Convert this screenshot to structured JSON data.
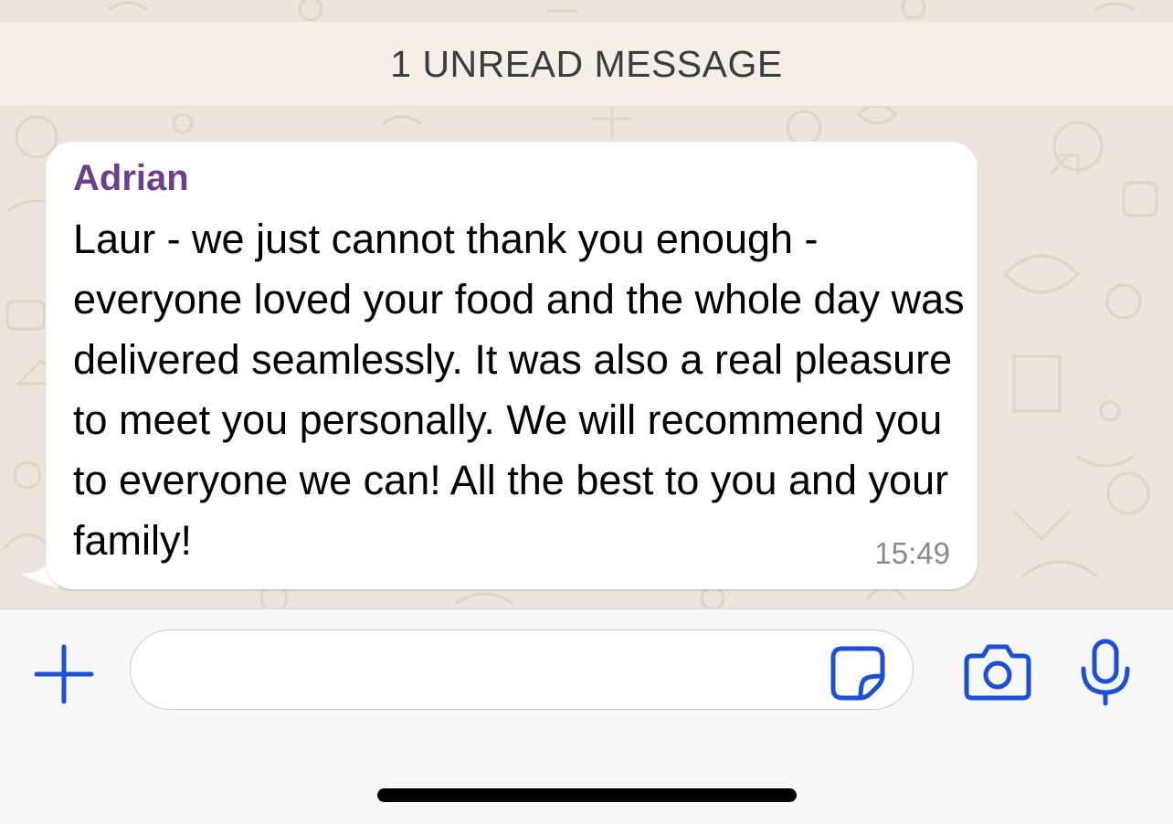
{
  "banner": {
    "unread_label": "1 UNREAD MESSAGE"
  },
  "message": {
    "sender": "Adrian",
    "text": "Laur - we just cannot thank you enough - everyone loved your food and the whole day was delivered seamlessly. It was also a real pleasure to meet you personally. We will recommend you to everyone we can! All the best to you and your family!",
    "time": "15:49"
  },
  "composer": {
    "input_value": "",
    "icons": [
      "plus-icon",
      "sticker-icon",
      "camera-icon",
      "microphone-icon"
    ]
  },
  "colors": {
    "accent": "#1c4fd8",
    "sender_name": "#6e3f8a",
    "wallpaper": "#ece5dc",
    "banner": "#f5efe6"
  }
}
